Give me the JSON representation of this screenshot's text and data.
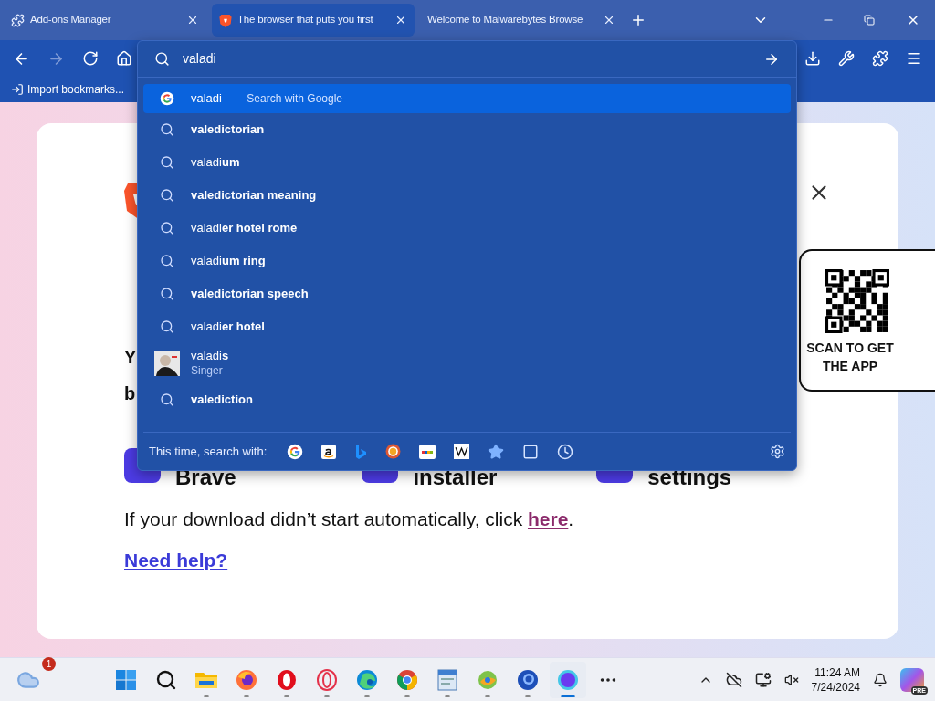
{
  "tabs": [
    {
      "title": "Add-ons Manager",
      "selected": false
    },
    {
      "title": "The browser that puts you first",
      "selected": true
    },
    {
      "title": "Welcome to Malwarebytes Browse",
      "selected": false
    }
  ],
  "toolbar": {
    "forward_disabled": true
  },
  "bookmarks": [
    {
      "label": "Import bookmarks..."
    }
  ],
  "address": {
    "value": "valadi"
  },
  "suggestions": [
    {
      "kind": "search",
      "text": "valadi",
      "hint": "— Search with Google",
      "selected": true
    },
    {
      "kind": "suggestion",
      "text": "valedictorian",
      "bold": true,
      "selected": false
    },
    {
      "kind": "suggestion",
      "text": "valadi**um**",
      "bold": false,
      "selected": false
    },
    {
      "kind": "suggestion",
      "text": "valedictorian meaning",
      "bold": true,
      "selected": false
    },
    {
      "kind": "suggestion",
      "text": "valadi**er hotel rome**",
      "bold": false,
      "selected": false
    },
    {
      "kind": "suggestion",
      "text": "valadi**um ring**",
      "bold": false,
      "selected": false
    },
    {
      "kind": "suggestion",
      "text": "valedictorian speech",
      "bold": true,
      "selected": false
    },
    {
      "kind": "suggestion",
      "text": "valadi**er hotel**",
      "bold": false,
      "selected": false
    },
    {
      "kind": "entity",
      "text": "valadi**s**",
      "subtitle": "Singer",
      "bold": false,
      "selected": false
    },
    {
      "kind": "suggestion",
      "text": "valediction",
      "bold": true,
      "selected": false
    }
  ],
  "search_with": {
    "label": "This time, search with:",
    "engines": [
      {
        "kind": "google"
      },
      {
        "kind": "amazon"
      },
      {
        "kind": "bing"
      },
      {
        "kind": "duckduckgo"
      },
      {
        "kind": "ebay"
      },
      {
        "kind": "wikipedia"
      },
      {
        "kind": "bookmarks"
      },
      {
        "kind": "tabs"
      },
      {
        "kind": "history"
      }
    ]
  },
  "page": {
    "subheading_lines": [
      "Y",
      "b"
    ],
    "steps": [
      {
        "title": "Brave"
      },
      {
        "title": "installer"
      },
      {
        "title": "settings"
      }
    ],
    "download_text": "If your download didn’t start automatically, click ",
    "download_link": "here",
    "download_end": ".",
    "help_link": "Need help?",
    "qr_label": "SCAN TO GET THE APP"
  },
  "taskbar": {
    "notification_count": "1",
    "apps": [
      {
        "kind": "windows",
        "running": false,
        "active": false
      },
      {
        "kind": "search",
        "running": false,
        "active": false
      },
      {
        "kind": "folder",
        "running": true,
        "active": false
      },
      {
        "kind": "firefox",
        "running": true,
        "active": false
      },
      {
        "kind": "opera",
        "running": true,
        "active": false
      },
      {
        "kind": "opera-gx",
        "running": true,
        "active": false
      },
      {
        "kind": "edge",
        "running": true,
        "active": false
      },
      {
        "kind": "chrome",
        "running": true,
        "active": false
      },
      {
        "kind": "notepad",
        "running": true,
        "active": false
      },
      {
        "kind": "swirl",
        "running": true,
        "active": false
      },
      {
        "kind": "globe",
        "running": true,
        "active": false
      },
      {
        "kind": "circle",
        "running": true,
        "active": true
      },
      {
        "kind": "more",
        "running": false,
        "active": false
      }
    ],
    "time": "11:24 AM",
    "date": "7/24/2024",
    "copilot_badge": "PRE"
  }
}
